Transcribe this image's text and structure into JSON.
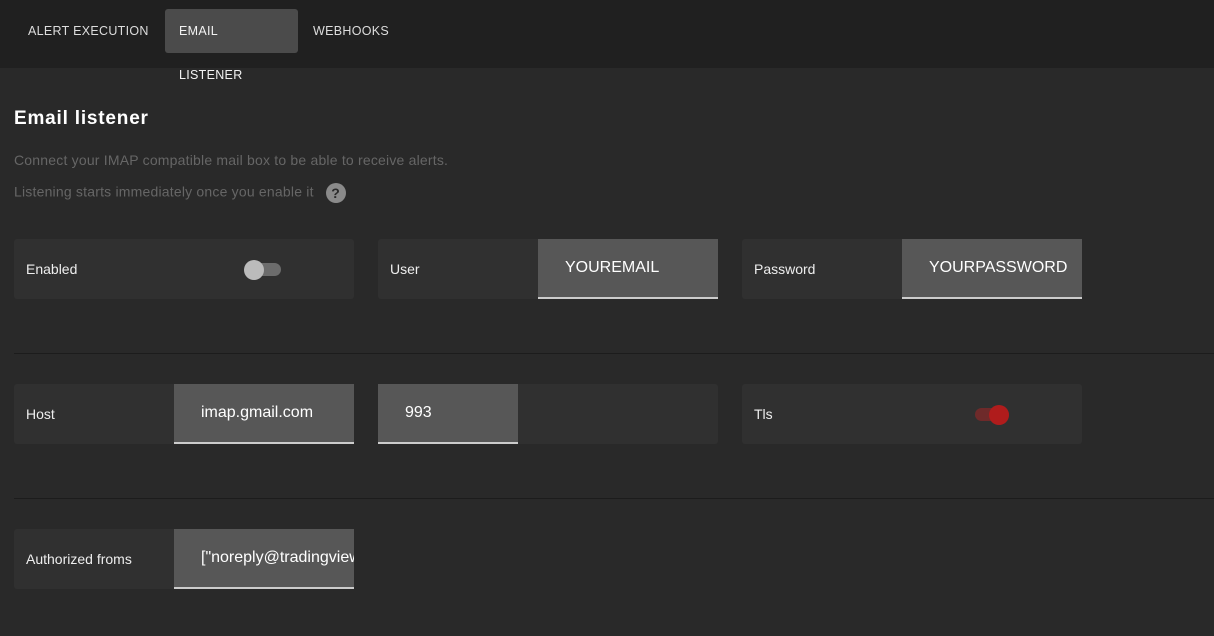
{
  "tabs": [
    {
      "label": "ALERT EXECUTION"
    },
    {
      "label": "EMAIL LISTENER",
      "active": true
    },
    {
      "label": "WEBHOOKS"
    }
  ],
  "title": "Email listener",
  "description": "Connect your IMAP compatible mail box to be able to receive alerts.",
  "note": "Listening starts immediately once you enable it",
  "help_icon": "?",
  "fields": {
    "enabled": {
      "label": "Enabled",
      "value": false
    },
    "user": {
      "label": "User",
      "value": "YOUREMAIL"
    },
    "password": {
      "label": "Password",
      "value": "YOURPASSWORD"
    },
    "host": {
      "label": "Host",
      "value": "imap.gmail.com"
    },
    "port": {
      "value": "993"
    },
    "tls": {
      "label": "Tls",
      "value": true
    },
    "authorized_froms": {
      "label": "Authorized froms",
      "value": "[\"noreply@tradingview.com\"]"
    }
  },
  "colors": {
    "accent": "#b01c1c"
  }
}
